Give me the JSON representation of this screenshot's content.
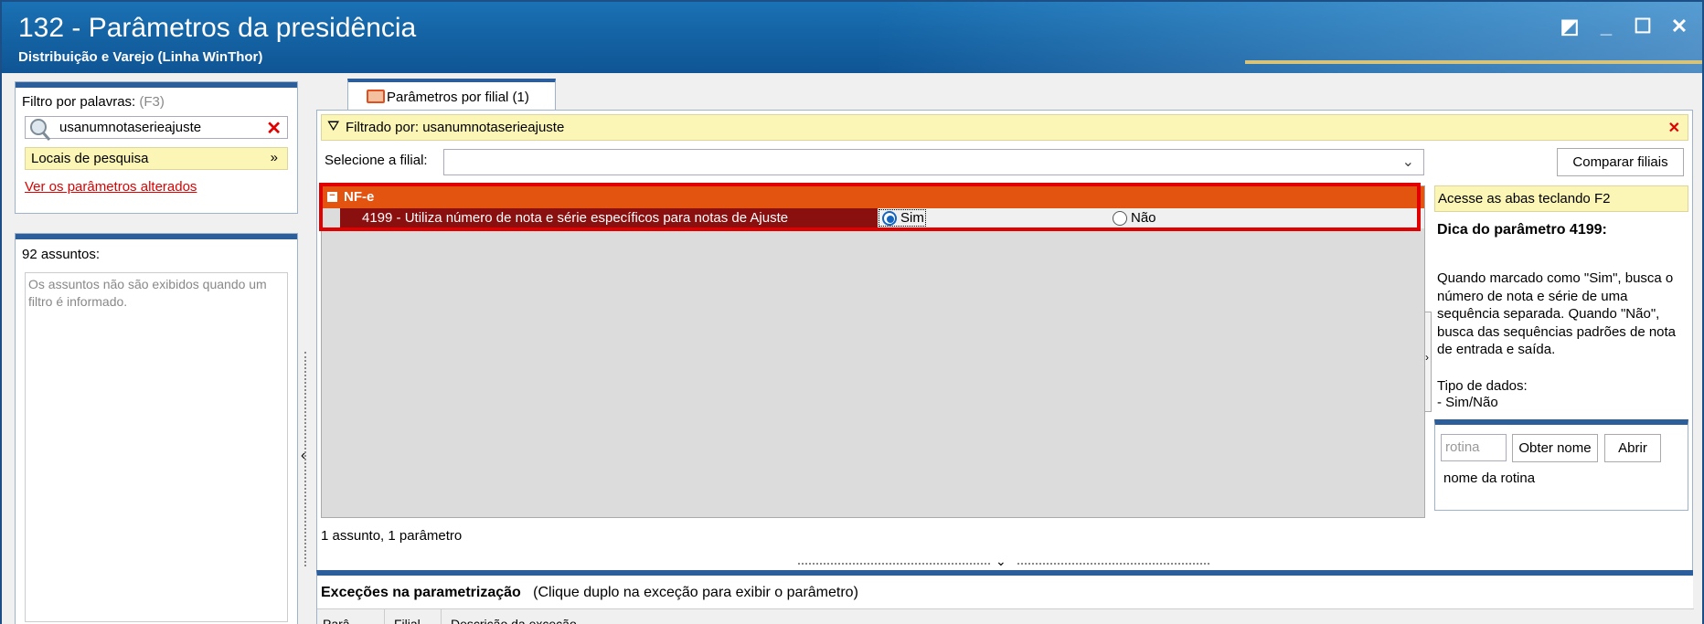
{
  "window": {
    "title": "132 - Parâmetros da presidência",
    "subtitle": "Distribuição e Varejo (Linha WinThor)",
    "controls": [
      "◩",
      "_",
      "☐",
      "✕"
    ]
  },
  "filter_panel": {
    "label": "Filtro por palavras:",
    "shortcut": "(F3)",
    "search_value": "usanumnotaserieajuste",
    "locais_label": "Locais de pesquisa",
    "changed_link": "Ver os parâmetros alterados"
  },
  "subjects_panel": {
    "count_label": "92 assuntos:",
    "note": "Os assuntos não são exibidos quando um filtro é informado."
  },
  "tab": {
    "label": "Parâmetros por filial  (1)"
  },
  "main": {
    "filtered_text": "Filtrado por: usanumnotaserieajuste",
    "select_filial_label": "Selecione a filial:",
    "compare_button": "Comparar filiais",
    "group": {
      "title": "NF-e",
      "toggle": "−",
      "param": {
        "description": "4199 - Utiliza número de nota e série específicos para notas de Ajuste",
        "option_yes": "Sim",
        "option_no": "Não",
        "selected": "Sim"
      }
    },
    "count_text": "1 assunto, 1 parâmetro"
  },
  "side": {
    "hint": "Acesse as abas teclando F2",
    "dica_title": "Dica do parâmetro 4199:",
    "dica_text": "Quando marcado como \"Sim\", busca o número de nota e série de uma sequência separada. Quando \"Não\", busca das sequências padrões de nota de entrada e saída.",
    "tipo_text": "Tipo de dados:\n - Sim/Não",
    "rotina_placeholder": "rotina",
    "obter_button": "Obter nome",
    "abrir_button": "Abrir",
    "nome_rotina": "nome da rotina"
  },
  "exceptions": {
    "title": "Exceções na parametrização",
    "subtitle": "(Clique duplo na exceção para exibir o parâmetro)",
    "columns": [
      "Parâ",
      "Filial",
      "Descrição da exceção"
    ]
  },
  "colors": {
    "title_bar": "#1565a6",
    "group_header": "#e35411",
    "selected_row": "#8a0f0f",
    "highlight_border": "#e00000",
    "yellow_bar": "#fbf5b6"
  }
}
